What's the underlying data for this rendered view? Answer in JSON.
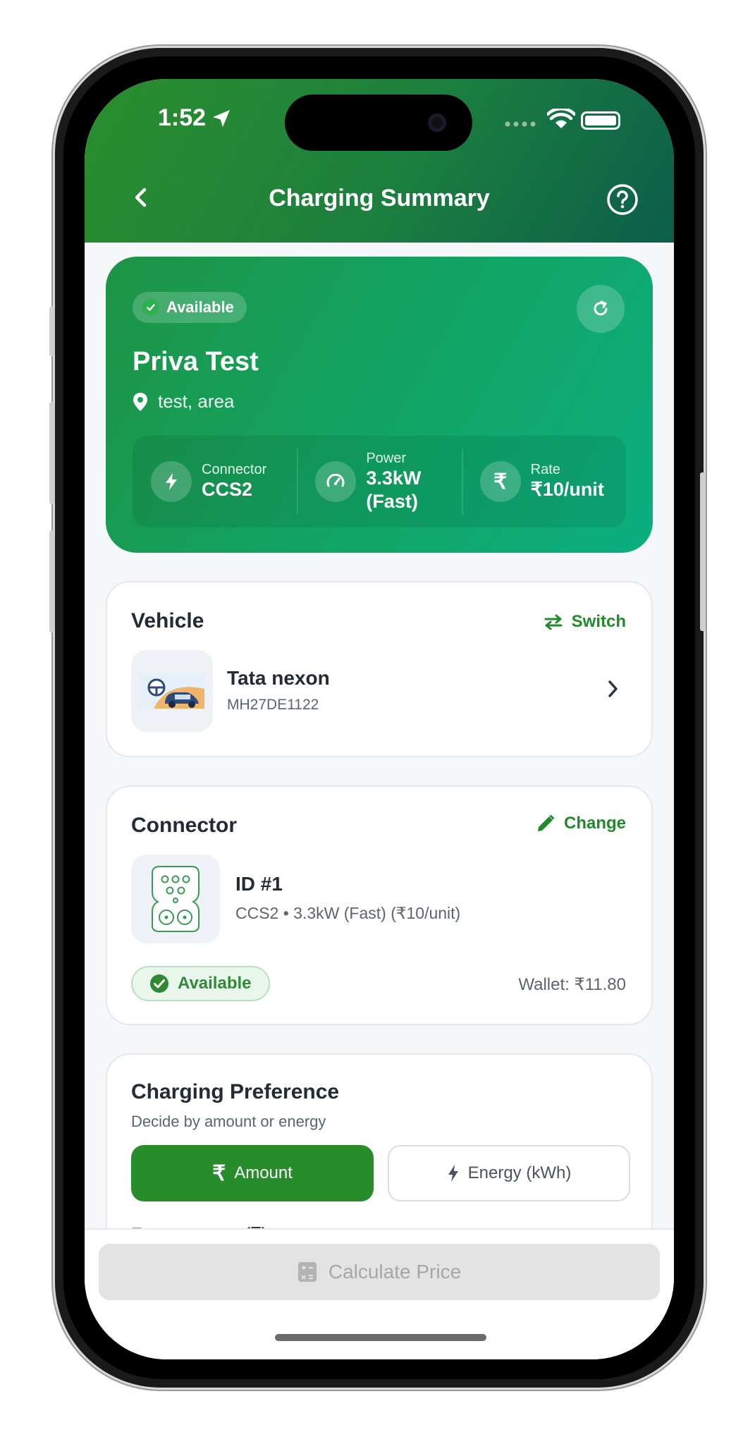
{
  "status_bar": {
    "time": "1:52"
  },
  "header": {
    "title": "Charging Summary"
  },
  "station": {
    "status": "Available",
    "name": "Priva Test",
    "location": "test, area",
    "stats": {
      "connector_label": "Connector",
      "connector_value": "CCS2",
      "power_label": "Power",
      "power_value": "3.3kW (Fast)",
      "rate_label": "Rate",
      "rate_value": "₹10/unit",
      "rate_icon": "₹"
    }
  },
  "vehicle": {
    "title": "Vehicle",
    "action": "Switch",
    "name": "Tata nexon",
    "plate": "MH27DE1122"
  },
  "connector": {
    "title": "Connector",
    "action": "Change",
    "id": "ID #1",
    "detail": "CCS2 • 3.3kW (Fast) (₹10/unit)",
    "status": "Available",
    "wallet": "Wallet: ₹11.80"
  },
  "preference": {
    "title": "Charging Preference",
    "subtitle": "Decide by amount or energy",
    "amount_label": "Amount",
    "energy_label": "Energy (kWh)",
    "selected": "Amount",
    "input_label": "Enter amount (₹)"
  },
  "footer": {
    "calculate_label": "Calculate Price"
  },
  "colors": {
    "brand_green": "#268d2a",
    "header_gradient_start": "#2a8f2c",
    "header_gradient_end": "#0b5e4a",
    "hero_gradient_end": "#0cae80",
    "disabled_button": "#e3e3e3"
  },
  "icons": [
    "back-icon",
    "help-icon",
    "check-icon",
    "refresh-icon",
    "location-pin-icon",
    "bolt-icon",
    "speedometer-icon",
    "rupee-icon",
    "swap-icon",
    "car-icon",
    "chevron-right-icon",
    "pencil-icon",
    "ccs2-connector-icon",
    "calculator-icon"
  ]
}
